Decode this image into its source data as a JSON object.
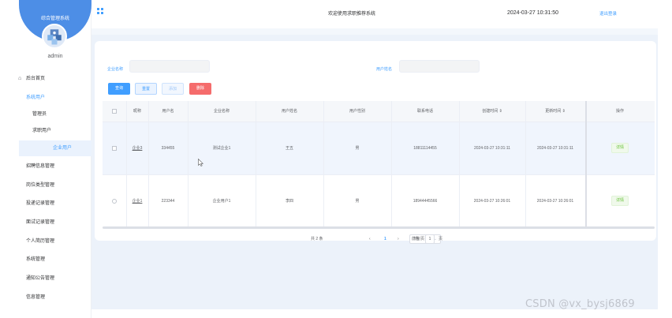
{
  "sidebar": {
    "title": "综合管理系统",
    "user": "admin",
    "home": "后台首页",
    "group": "系统用户",
    "items": [
      "管理员",
      "求职用户",
      "企业用户"
    ],
    "menus": [
      "招聘信息管理",
      "岗位类型管理",
      "投递记录管理",
      "面试记录管理",
      "个人简历管理",
      "系统管理",
      "通知公告管理",
      "信息管理"
    ]
  },
  "header": {
    "title": "欢迎使用求职推荐系统",
    "time": "2024-03-27 10:31:50",
    "logout": "退出登录"
  },
  "search": {
    "company_label": "企业名称",
    "company_placeholder": "",
    "user_label": "用户姓名",
    "user_placeholder": ""
  },
  "buttons": {
    "query": "查询",
    "reset": "重置",
    "add": "添加",
    "delete": "删除"
  },
  "table": {
    "headers": [
      "昵称",
      "用户名",
      "企业名称",
      "用户姓名",
      "用户性别",
      "联系电话",
      "创建时间 ⇕",
      "更新时间 ⇕",
      "操作"
    ],
    "rows": [
      {
        "nickname": "企业3",
        "username": "334455",
        "company": "测试企业1",
        "name": "王五",
        "gender": "男",
        "phone": "18811114455",
        "created": "2024-03-27 10:31:11",
        "updated": "2024-03-27 10:31:11",
        "action": "详情"
      },
      {
        "nickname": "企业1",
        "username": "223344",
        "company": "企业用户1",
        "name": "李四",
        "gender": "男",
        "phone": "18944445566",
        "created": "2024-03-27 10:26:01",
        "updated": "2024-03-27 10:26:01",
        "action": "详情"
      }
    ]
  },
  "pagination": {
    "total": "共 2 条",
    "page_size": "7条/页",
    "prev": "‹",
    "current": "1",
    "next": "›",
    "goto_label": "前往",
    "goto_value": "1",
    "page_suffix": "页"
  },
  "watermark": "CSDN @vx_bysj6869",
  "colors": {
    "accent": "#409eff",
    "danger": "#f56c6c",
    "success": "#67c23a",
    "sidebar_head": "#4d8ee6"
  }
}
